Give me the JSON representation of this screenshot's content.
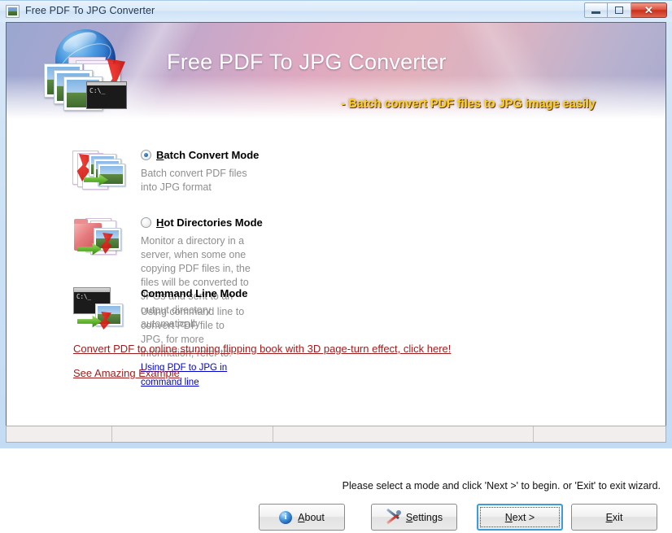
{
  "window": {
    "title": "Free PDF To JPG Converter",
    "icon": "image-file-icon",
    "controls": {
      "minimize": "minimize-button",
      "maximize": "maximize-button",
      "close_glyph": "✕"
    }
  },
  "banner": {
    "title": "Free PDF To JPG Converter",
    "tagline": "- Batch convert PDF files to JPG image easily",
    "colors": {
      "tagline": "#ffd21a",
      "title": "#ffffff"
    }
  },
  "modes": [
    {
      "id": "batch-convert-mode",
      "accel": "B",
      "title_rest": "atch Convert Mode",
      "selected": true,
      "has_radio": true,
      "description": "Batch convert PDF files into JPG format",
      "icon": "pdf-pages-to-photos-icon"
    },
    {
      "id": "hot-directories-mode",
      "accel": "H",
      "title_rest": "ot Directories Mode",
      "selected": false,
      "has_radio": true,
      "description": "Monitor a directory in a server, when some one copying PDF files in, the files will be converted to JPGs and sent to an output directory automatically",
      "icon": "folder-to-photos-icon"
    },
    {
      "id": "command-line-mode",
      "accel": "",
      "title_rest": "Command Line Mode",
      "selected": false,
      "has_radio": false,
      "description": "Using command line to convert PDF file to JPG, for more information, refer to:",
      "link": "Using PDF to JPG in command line",
      "icon": "console-window-icon"
    }
  ],
  "promo_links": [
    {
      "text": "Convert PDF to online stunning flipping book with 3D page-turn effect, click here!",
      "color": "#9e1b1b"
    },
    {
      "text": "See Amazing Example ",
      "color": "#9e1b1b"
    }
  ],
  "hint": "Please select a mode and click 'Next >' to begin. or 'Exit' to exit wizard.",
  "buttons": [
    {
      "id": "about-button",
      "accel": "A",
      "before": "",
      "after": "bout",
      "icon": "info-icon",
      "focused": false
    },
    {
      "id": "settings-button",
      "accel": "S",
      "before": "",
      "after": "ettings",
      "icon": "tools-icon",
      "focused": false
    },
    {
      "id": "next-button",
      "accel": "N",
      "before": "",
      "after": "ext >",
      "icon": "",
      "focused": true
    },
    {
      "id": "exit-button",
      "accel": "E",
      "before": "",
      "after": "xit",
      "icon": "",
      "focused": false
    }
  ],
  "status_bar": {
    "panels": [
      "",
      "",
      "",
      ""
    ]
  }
}
